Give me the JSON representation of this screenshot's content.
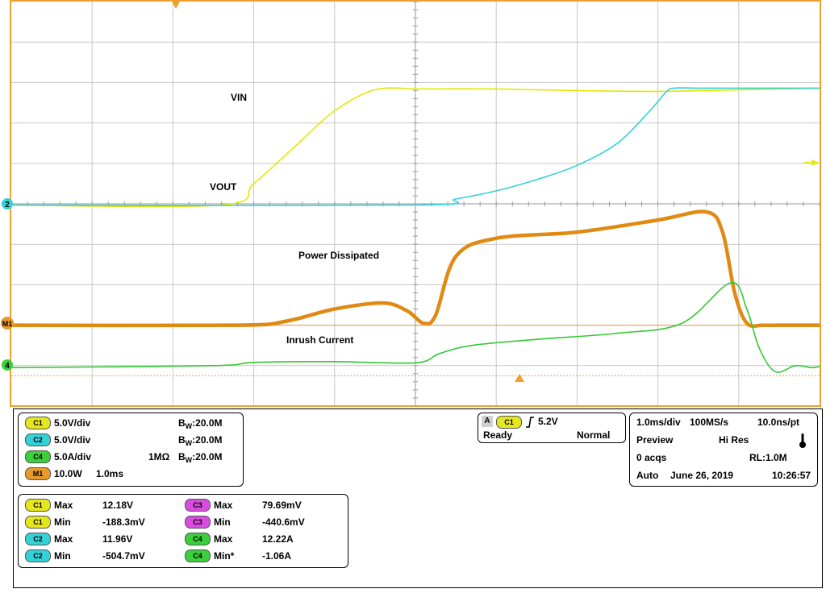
{
  "chart_data": {
    "type": "line",
    "xlim": [
      0,
      10
    ],
    "ylim": [
      -5,
      5
    ],
    "grid": true,
    "series": [
      {
        "name": "VIN",
        "color": "#e6e600",
        "x": [
          0,
          2.6,
          3.0,
          3.5,
          4.0,
          4.5,
          5.0,
          5.2,
          6.0,
          7.0,
          8.0,
          9.0,
          10.0
        ],
        "y": [
          -0.03,
          -0.03,
          0.5,
          1.4,
          2.3,
          2.82,
          2.84,
          2.84,
          2.84,
          2.8,
          2.78,
          2.82,
          2.86
        ]
      },
      {
        "name": "VOUT",
        "color": "#33d1d8",
        "x": [
          0,
          5.0,
          5.5,
          6.0,
          6.5,
          7.0,
          7.5,
          7.9,
          8.1,
          8.2,
          8.5,
          9.0,
          10.0
        ],
        "y": [
          -0.03,
          -0.03,
          0.12,
          0.32,
          0.6,
          0.95,
          1.5,
          2.3,
          2.76,
          2.86,
          2.86,
          2.86,
          2.86
        ]
      },
      {
        "name": "Power Dissipated",
        "color": "#e08a14",
        "x": [
          0,
          2.8,
          3.4,
          4.0,
          4.6,
          4.9,
          5.1,
          5.25,
          5.5,
          6.0,
          7.0,
          8.0,
          8.6,
          8.8,
          8.95,
          9.1,
          9.3,
          9.5,
          10.0
        ],
        "y": [
          -3.0,
          -3.0,
          -2.9,
          -2.6,
          -2.45,
          -2.65,
          -2.95,
          -2.75,
          -1.3,
          -0.85,
          -0.7,
          -0.4,
          -0.2,
          -0.7,
          -2.2,
          -2.95,
          -3.0,
          -3.0,
          -3.0
        ]
      },
      {
        "name": "Inrush Current",
        "color": "#33c933",
        "x": [
          0,
          2.5,
          3.0,
          4.0,
          5.0,
          5.3,
          5.7,
          6.5,
          7.5,
          8.3,
          8.9,
          9.1,
          9.25,
          9.45,
          9.7,
          9.9,
          10.0
        ],
        "y": [
          -4.05,
          -4.0,
          -3.92,
          -3.9,
          -3.93,
          -3.7,
          -3.5,
          -3.35,
          -3.2,
          -2.95,
          -1.95,
          -2.6,
          -3.55,
          -4.15,
          -4.0,
          -4.05,
          -4.02
        ]
      }
    ],
    "annotations": [
      "VIN",
      "VOUT",
      "Power Dissipated",
      "Inrush Current"
    ],
    "markers": {
      "ch2": "2",
      "m1": "M1",
      "ch4": "4"
    }
  },
  "channels": [
    {
      "badge": "C1",
      "cls": "b-c1",
      "scale": "5.0V/div",
      "imp": "",
      "bw_b": "B",
      "bw_w": "W",
      "bw": ":20.0M"
    },
    {
      "badge": "C2",
      "cls": "b-c2",
      "scale": "5.0V/div",
      "imp": "",
      "bw_b": "B",
      "bw_w": "W",
      "bw": ":20.0M"
    },
    {
      "badge": "C4",
      "cls": "b-c4",
      "scale": "5.0A/div",
      "imp": "1MΩ",
      "bw_b": "B",
      "bw_w": "W",
      "bw": ":20.0M"
    },
    {
      "badge": "M1",
      "cls": "b-m1",
      "scale": "10.0W",
      "imp": "1.0ms",
      "bw_b": "",
      "bw_w": "",
      "bw": ""
    }
  ],
  "trigger": {
    "source_tag": "A",
    "source": "C1",
    "level": "5.2V",
    "state": "Ready",
    "mode": "Normal"
  },
  "timebase": {
    "scale": "1.0ms/div",
    "rate": "100MS/s",
    "res": "10.0ns/pt",
    "preview": "Preview",
    "acq_mode": "Hi Res",
    "acqs": "0 acqs",
    "rl": "RL:1.0M",
    "auto": "Auto",
    "date": "June 26, 2019",
    "time": "10:26:57"
  },
  "measurements": [
    {
      "badge": "C1",
      "cls": "b-c1",
      "label": "Max",
      "value": "12.18V"
    },
    {
      "badge": "C1",
      "cls": "b-c1",
      "label": "Min",
      "value": "-188.3mV"
    },
    {
      "badge": "C2",
      "cls": "b-c2",
      "label": "Max",
      "value": "11.96V"
    },
    {
      "badge": "C2",
      "cls": "b-c2",
      "label": "Min",
      "value": "-504.7mV"
    },
    {
      "badge": "C3",
      "cls": "b-c3",
      "label": "Max",
      "value": "79.69mV"
    },
    {
      "badge": "C3",
      "cls": "b-c3",
      "label": "Min",
      "value": "-440.6mV"
    },
    {
      "badge": "C4",
      "cls": "b-c4",
      "label": "Max",
      "value": "12.22A"
    },
    {
      "badge": "C4",
      "cls": "b-c4",
      "label": "Min*",
      "value": "-1.06A"
    }
  ]
}
